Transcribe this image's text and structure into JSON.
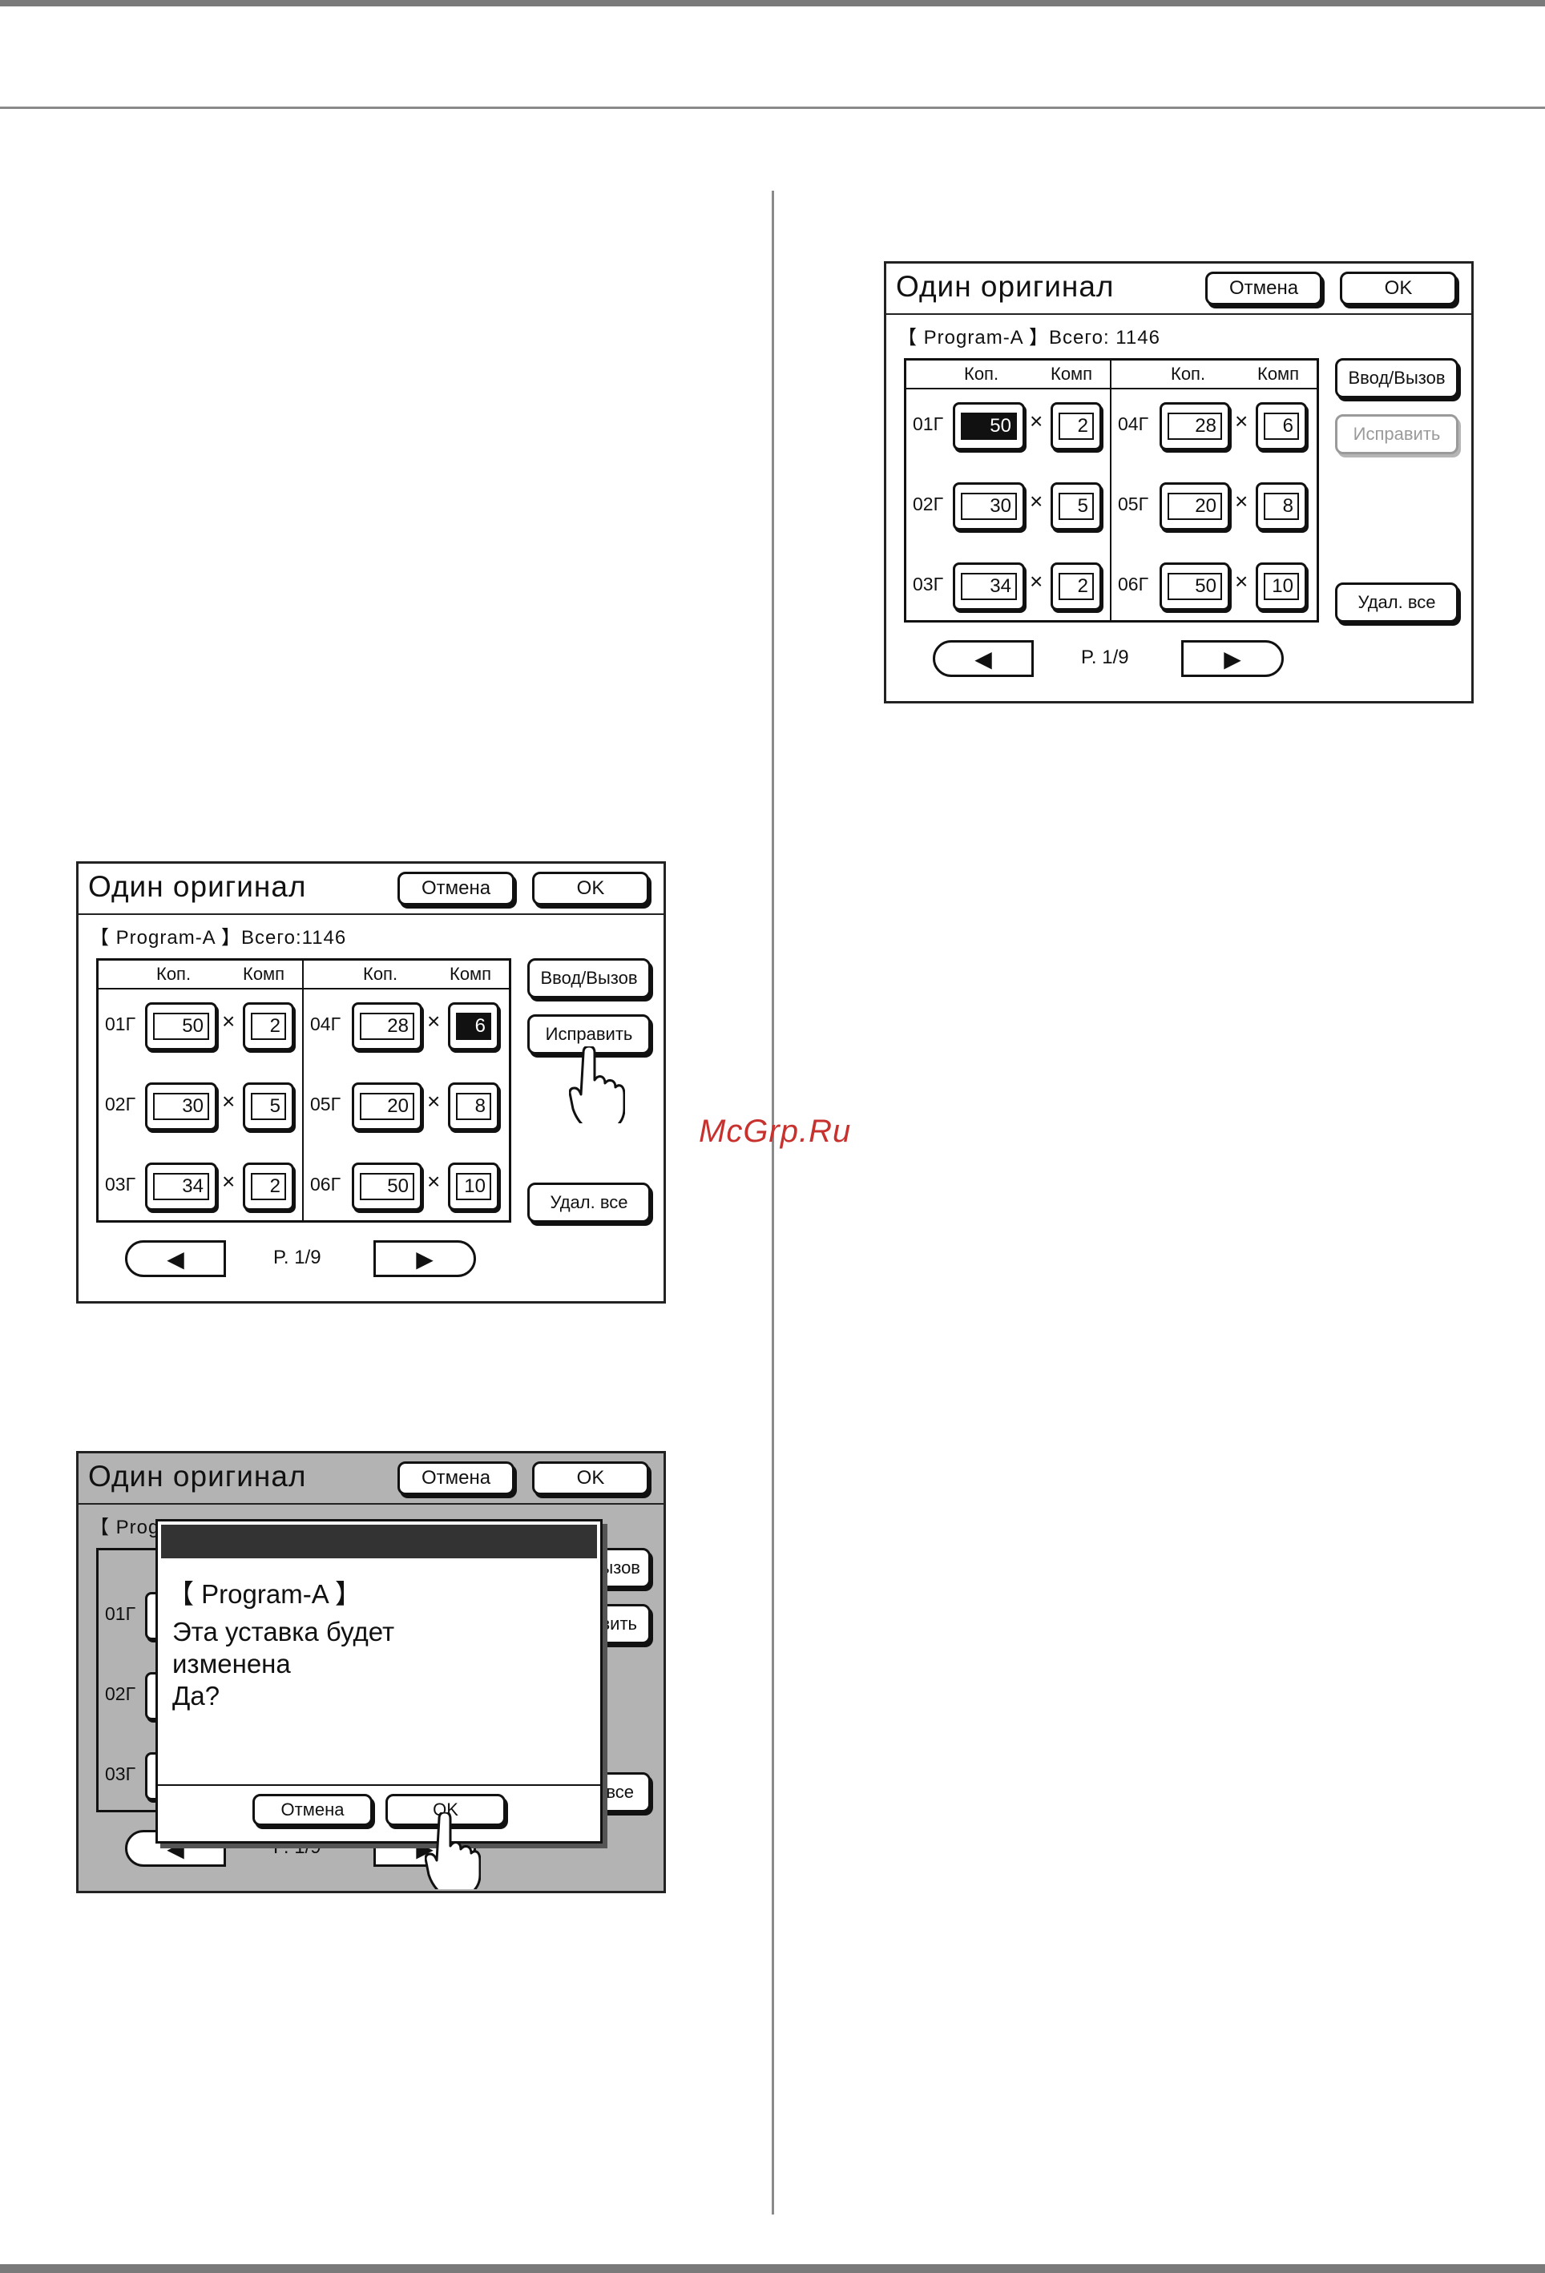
{
  "watermark": "McGrp.Ru",
  "panels": [
    {
      "title": "Один оригинал",
      "cancel": "Отмена",
      "ok": "OK",
      "program": "【 Program-A 】Всего:1146",
      "col_copies": "Коп.",
      "col_sets": "Комп",
      "rows": [
        {
          "l1": "01Г",
          "c1": "50",
          "s1": "2",
          "l2": "04Г",
          "c2": "28",
          "s2": "6"
        },
        {
          "l1": "02Г",
          "c1": "30",
          "s1": "5",
          "l2": "05Г",
          "c2": "20",
          "s2": "8"
        },
        {
          "l1": "03Г",
          "c1": "34",
          "s1": "2",
          "l2": "06Г",
          "c2": "50",
          "s2": "10"
        }
      ],
      "btn_entry": "Ввод/Вызов",
      "btn_edit": "Исправить",
      "btn_clear": "Удал. все",
      "prev": "◀",
      "next": "▶",
      "page": "P. 1/9"
    },
    {
      "title": "Один оригинал",
      "cancel": "Отмена",
      "ok": "OK",
      "program": "【 Program-A 】Всего: 1146",
      "col_copies": "Коп.",
      "col_sets": "Комп",
      "rows": [
        {
          "l1": "01Г",
          "c1": "50",
          "s1": "2",
          "l2": "04Г",
          "c2": "28",
          "s2": "6"
        },
        {
          "l1": "02Г",
          "c1": "30",
          "s1": "5",
          "l2": "05Г",
          "c2": "20",
          "s2": "8"
        },
        {
          "l1": "03Г",
          "c1": "34",
          "s1": "2",
          "l2": "06Г",
          "c2": "50",
          "s2": "10"
        }
      ],
      "btn_entry": "Ввод/Вызов",
      "btn_edit": "Исправить",
      "btn_clear": "Удал. все",
      "prev": "◀",
      "next": "▶",
      "page": "P. 1/9"
    }
  ],
  "dialog_panel": {
    "title": "Один оригинал",
    "cancel": "Отмена",
    "ok": "OK",
    "program_partial": "【 Prog",
    "row_labels": [
      "01Г",
      "02Г",
      "03Г"
    ],
    "entry_partial": "ызов",
    "edit_partial": "вить",
    "clear_partial": "все",
    "prev": "◀",
    "next": "▶",
    "page": "P. 1/9",
    "dialog": {
      "title": "【 Program-A 】",
      "message_lines": [
        "Эта уставка будет",
        "изменена",
        "Да?"
      ],
      "cancel": "Отмена",
      "ok": "OK"
    }
  }
}
